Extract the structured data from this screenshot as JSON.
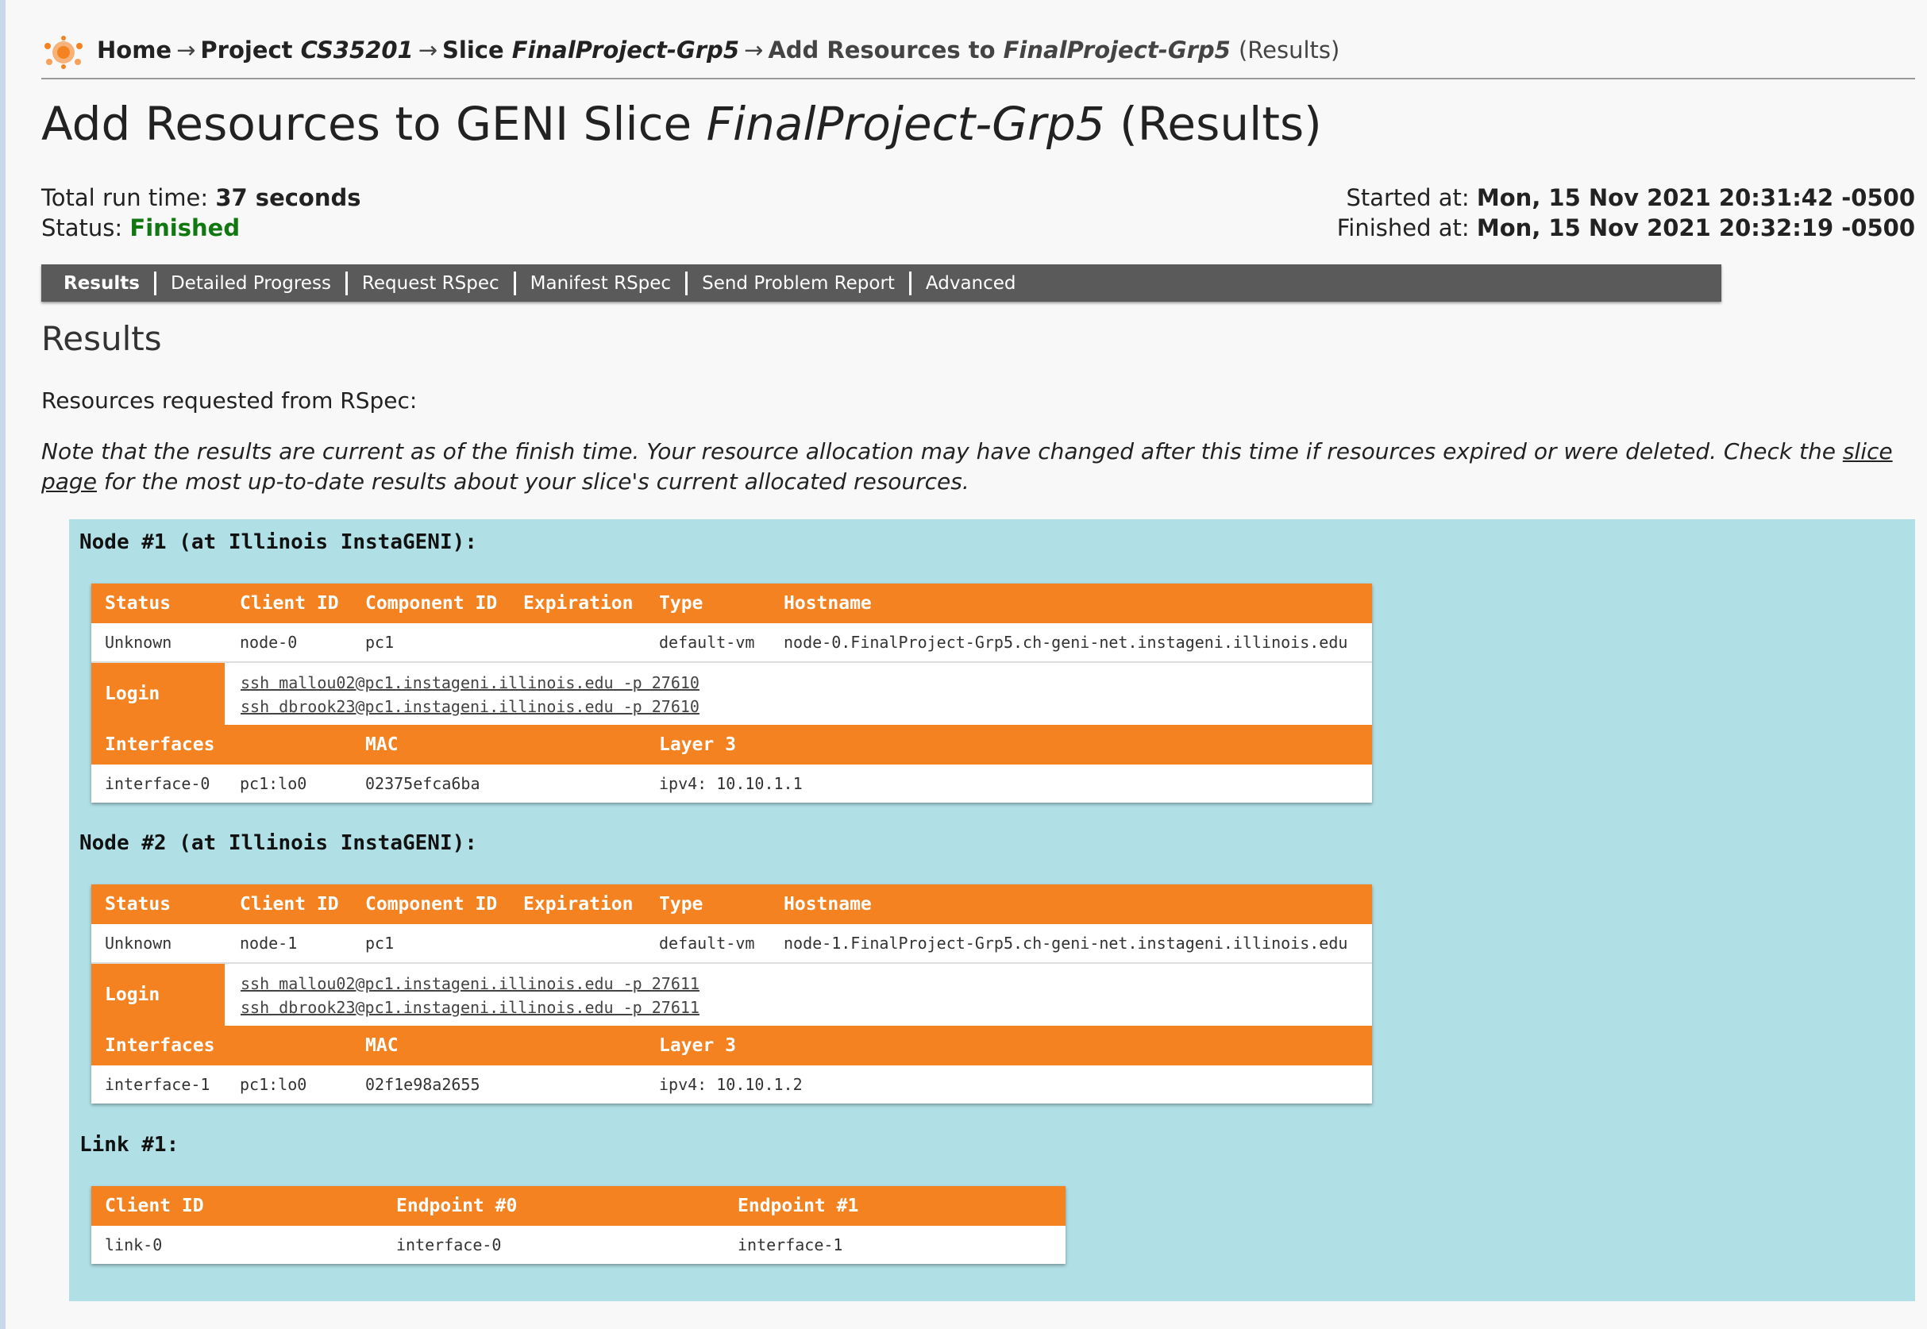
{
  "breadcrumb": {
    "home": "Home",
    "project_label": "Project",
    "project_name": "CS35201",
    "slice_label": "Slice",
    "slice_name": "FinalProject-Grp5",
    "current_prefix": "Add Resources to",
    "current_slice": "FinalProject-Grp5",
    "current_suffix": "(Results)",
    "separator": "→"
  },
  "title": {
    "prefix": "Add Resources to GENI Slice",
    "slice": "FinalProject-Grp5",
    "suffix": "(Results)"
  },
  "meta": {
    "run_time_label": "Total run time:",
    "run_time_value": "37 seconds",
    "status_label": "Status:",
    "status_value": "Finished",
    "status_color": "#117711",
    "started_label": "Started at:",
    "started_value": "Mon, 15 Nov 2021 20:31:42 -0500",
    "finished_label": "Finished at:",
    "finished_value": "Mon, 15 Nov 2021 20:32:19 -0500"
  },
  "tabs": [
    "Results",
    "Detailed Progress",
    "Request RSpec",
    "Manifest RSpec",
    "Send Problem Report",
    "Advanced"
  ],
  "results": {
    "heading": "Results",
    "requested_text": "Resources requested from RSpec:",
    "note_before_link": "Note that the results are current as of the finish time. Your resource allocation may have changed after this time if resources expired or were deleted. Check the ",
    "note_link": "slice page",
    "note_after_link": " for the most up-to-date results about your slice's current allocated resources."
  },
  "colors": {
    "panel_bg": "#b0dfe5",
    "header_orange": "#f58220",
    "tabbar_bg": "#5a5a5a"
  },
  "node_headers": {
    "status": "Status",
    "client_id": "Client ID",
    "component_id": "Component ID",
    "expiration": "Expiration",
    "type": "Type",
    "hostname": "Hostname",
    "login": "Login",
    "interfaces": "Interfaces",
    "mac": "MAC",
    "layer3": "Layer 3"
  },
  "nodes": [
    {
      "title": "Node #1 (at Illinois InstaGENI):",
      "status": "Unknown",
      "client_id": "node-0",
      "component_id": "pc1",
      "expiration": "",
      "type": "default-vm",
      "hostname": "node-0.FinalProject-Grp5.ch-geni-net.instageni.illinois.edu",
      "logins": [
        "ssh mallou02@pc1.instageni.illinois.edu -p 27610",
        "ssh dbrook23@pc1.instageni.illinois.edu -p 27610"
      ],
      "interface": "interface-0",
      "iface_client": "pc1:lo0",
      "mac": "02375efca6ba",
      "layer3": "ipv4: 10.10.1.1"
    },
    {
      "title": "Node #2 (at Illinois InstaGENI):",
      "status": "Unknown",
      "client_id": "node-1",
      "component_id": "pc1",
      "expiration": "",
      "type": "default-vm",
      "hostname": "node-1.FinalProject-Grp5.ch-geni-net.instageni.illinois.edu",
      "logins": [
        "ssh mallou02@pc1.instageni.illinois.edu -p 27611",
        "ssh dbrook23@pc1.instageni.illinois.edu -p 27611"
      ],
      "interface": "interface-1",
      "iface_client": "pc1:lo0",
      "mac": "02f1e98a2655",
      "layer3": "ipv4: 10.10.1.2"
    }
  ],
  "link": {
    "title": "Link #1:",
    "headers": {
      "client_id": "Client ID",
      "endpoint0": "Endpoint #0",
      "endpoint1": "Endpoint #1"
    },
    "client_id": "link-0",
    "endpoint0": "interface-0",
    "endpoint1": "interface-1"
  }
}
